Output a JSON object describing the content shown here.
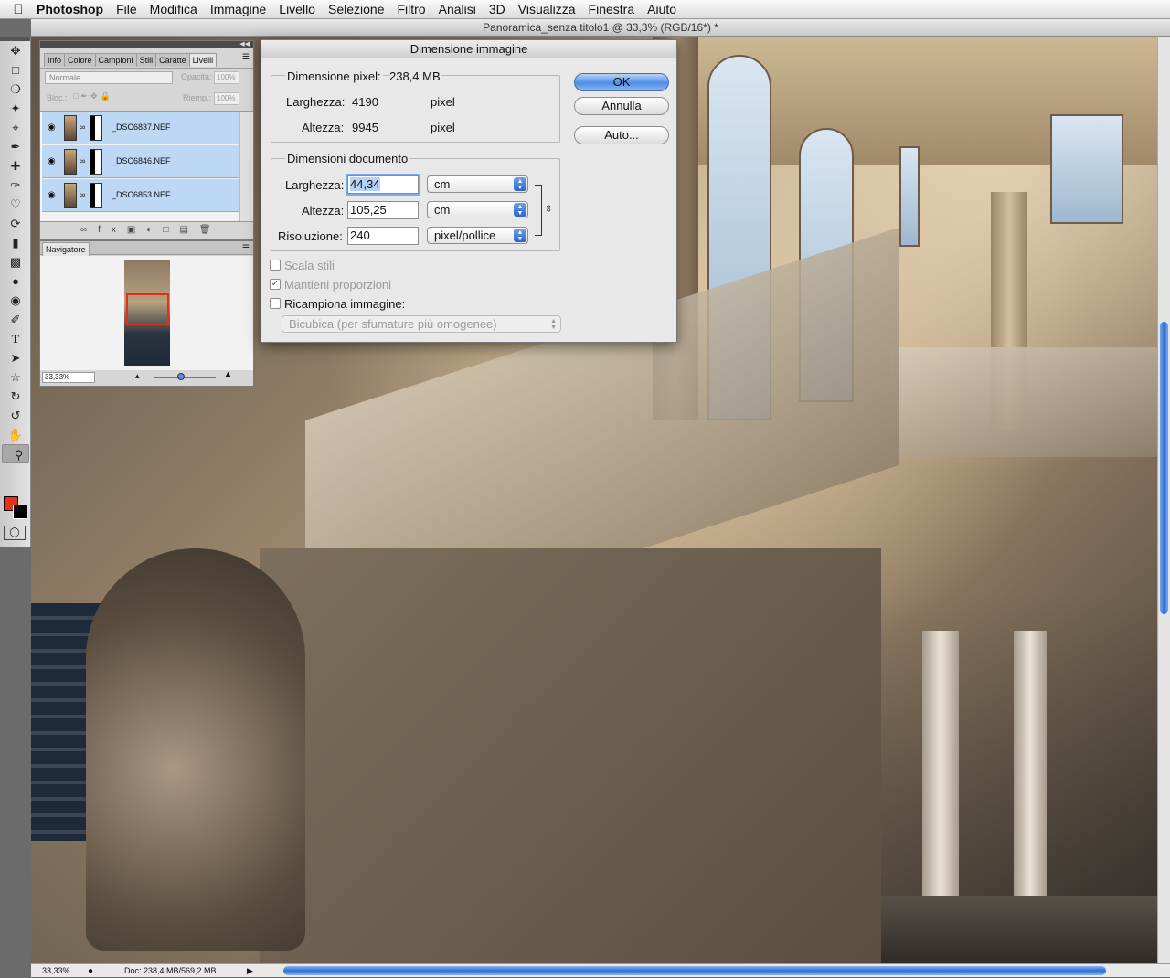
{
  "menubar": {
    "app": "Photoshop",
    "items": [
      "File",
      "Modifica",
      "Immagine",
      "Livello",
      "Selezione",
      "Filtro",
      "Analisi",
      "3D",
      "Visualizza",
      "Finestra",
      "Aiuto"
    ]
  },
  "document": {
    "title": "Panoramica_senza titolo1 @ 33,3% (RGB/16*) *"
  },
  "layers_panel": {
    "tabs": [
      "Info",
      "Colore",
      "Campioni",
      "Stili",
      "Caratte",
      "Livelli"
    ],
    "active_tab": "Livelli",
    "blend_mode": "Normale",
    "opacity_label": "Opacità:",
    "opacity_value": "100%",
    "lock_label": "Bloc.:",
    "fill_label": "Riemp.:",
    "fill_value": "100%",
    "layers": [
      {
        "name": "_DSC6837.NEF"
      },
      {
        "name": "_DSC6846.NEF"
      },
      {
        "name": "_DSC6853.NEF"
      }
    ]
  },
  "navigator": {
    "tab": "Navigatore",
    "zoom": "33,33%"
  },
  "status": {
    "zoom": "33,33%",
    "doc": "Doc: 238,4 MB/569,2 MB"
  },
  "dialog": {
    "title": "Dimensione immagine",
    "pixel_dim_label": "Dimensione pixel:",
    "pixel_dim_value": "238,4 MB",
    "px_width_label": "Larghezza:",
    "px_width_value": "4190",
    "px_width_unit": "pixel",
    "px_height_label": "Altezza:",
    "px_height_value": "9945",
    "px_height_unit": "pixel",
    "doc_dim_label": "Dimensioni documento",
    "doc_width_label": "Larghezza:",
    "doc_width_value": "44,34",
    "doc_width_unit": "cm",
    "doc_height_label": "Altezza:",
    "doc_height_value": "105,25",
    "doc_height_unit": "cm",
    "resolution_label": "Risoluzione:",
    "resolution_value": "240",
    "resolution_unit": "pixel/pollice",
    "scale_styles_label": "Scala stili",
    "constrain_label": "Mantieni proporzioni",
    "resample_label": "Ricampiona immagine:",
    "resample_method": "Bicubica (per sfumature più omogenee)",
    "ok_label": "OK",
    "cancel_label": "Annulla",
    "auto_label": "Auto...",
    "accent_color": "#4d8ee6"
  }
}
